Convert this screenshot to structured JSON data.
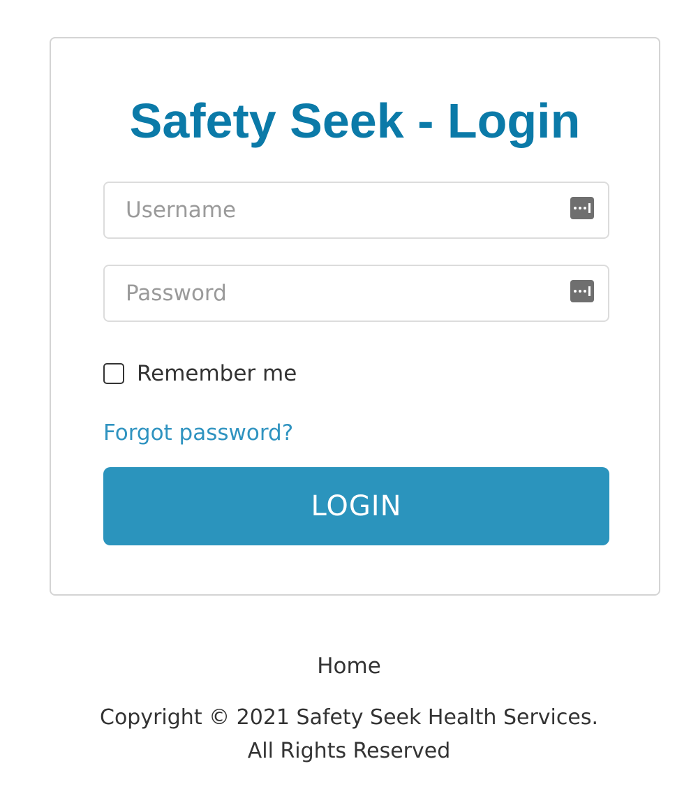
{
  "colors": {
    "brand": "#0b7aa8",
    "link": "#2f93c0",
    "button": "#2b94bd",
    "text": "#333333",
    "placeholder": "#9a9a9a"
  },
  "login_card": {
    "title": "Safety Seek - Login",
    "username": {
      "value": "",
      "placeholder": "Username",
      "icon": "password-manager-icon"
    },
    "password": {
      "value": "",
      "placeholder": "Password",
      "icon": "password-manager-icon"
    },
    "remember_me": {
      "label": "Remember me",
      "checked": false
    },
    "forgot_password_label": "Forgot password?",
    "login_button_label": "LOGIN"
  },
  "footer": {
    "home_link_label": "Home",
    "copyright_line1": "Copyright © 2021 Safety Seek Health Services.",
    "copyright_line2": "All Rights Reserved"
  }
}
